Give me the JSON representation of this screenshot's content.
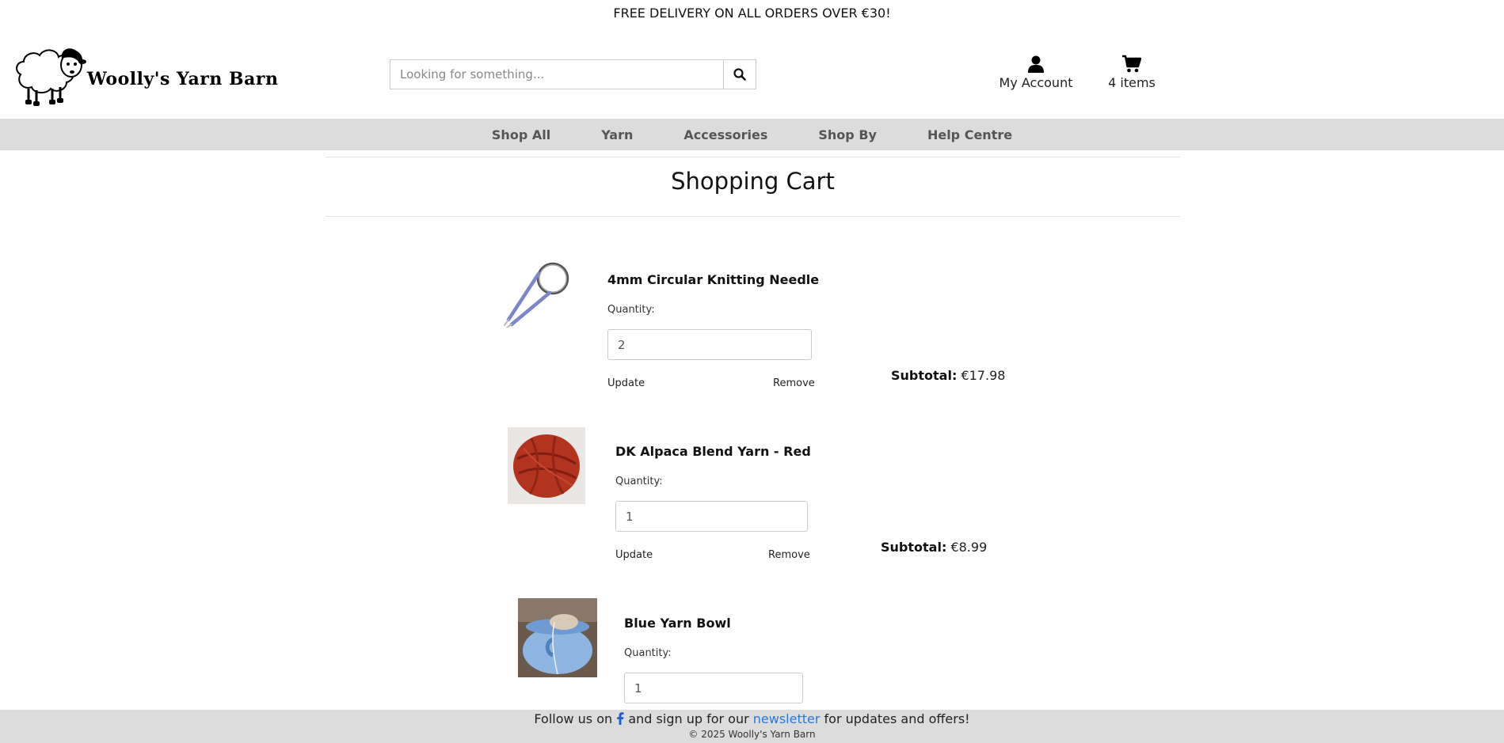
{
  "banner": "FREE DELIVERY ON ALL ORDERS OVER €30!",
  "brand": {
    "name": "Woolly's Yarn Barn"
  },
  "search": {
    "placeholder": "Looking for something..."
  },
  "header": {
    "account_label": "My Account",
    "cart_label": "4 items"
  },
  "nav": {
    "items": [
      "Shop All",
      "Yarn",
      "Accessories",
      "Shop By",
      "Help Centre"
    ]
  },
  "page": {
    "title": "Shopping Cart"
  },
  "cart": {
    "quantity_label": "Quantity:",
    "update_label": "Update",
    "remove_label": "Remove",
    "subtotal_label": "Subtotal:",
    "items": [
      {
        "name": "4mm Circular Knitting Needle",
        "quantity": "2",
        "subtotal": "€17.98",
        "image": "circular-needle"
      },
      {
        "name": "DK Alpaca Blend Yarn - Red",
        "quantity": "1",
        "subtotal": "€8.99",
        "image": "red-yarn-ball"
      },
      {
        "name": "Blue Yarn Bowl",
        "quantity": "1",
        "image": "blue-yarn-bowl"
      }
    ]
  },
  "footer": {
    "follow_prefix": "Follow us on",
    "follow_middle": "and sign up for our",
    "newsletter_link": "newsletter",
    "follow_suffix": "for updates and offers!",
    "copyright": "© 2025 Woolly's Yarn Barn"
  },
  "colors": {
    "nav_bg": "#dcdcdc",
    "link_blue": "#2a78d6",
    "facebook_blue": "#1a5fd1"
  }
}
